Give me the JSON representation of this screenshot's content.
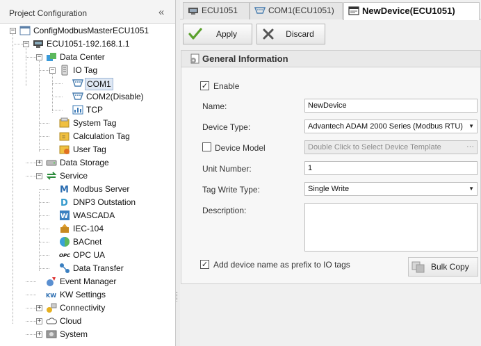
{
  "left_panel": {
    "title": "Project Configuration",
    "collapse_glyph": "«",
    "tree": [
      {
        "label": "ConfigModbusMasterECU1051",
        "icon": "project-icon",
        "expander": "−"
      },
      {
        "label": "ECU1051-192.168.1.1",
        "icon": "device-icon",
        "expander": "−"
      },
      {
        "label": "Data Center",
        "icon": "data-center-icon",
        "expander": "−"
      },
      {
        "label": "IO Tag",
        "icon": "io-tag-icon",
        "expander": "−"
      },
      {
        "label": "COM1",
        "icon": "com-port-icon",
        "selected": true
      },
      {
        "label": "COM2(Disable)",
        "icon": "com-port-icon"
      },
      {
        "label": "TCP",
        "icon": "tcp-icon"
      },
      {
        "label": "System Tag",
        "icon": "system-tag-icon"
      },
      {
        "label": "Calculation Tag",
        "icon": "calculation-tag-icon"
      },
      {
        "label": "User Tag",
        "icon": "user-tag-icon"
      },
      {
        "label": "Data Storage",
        "icon": "data-storage-icon",
        "expander": "+"
      },
      {
        "label": "Service",
        "icon": "service-icon",
        "expander": "−"
      },
      {
        "label": "Modbus Server",
        "icon": "modbus-icon"
      },
      {
        "label": "DNP3 Outstation",
        "icon": "dnp3-icon"
      },
      {
        "label": "WASCADA",
        "icon": "wascada-icon"
      },
      {
        "label": "IEC-104",
        "icon": "iec104-icon"
      },
      {
        "label": "BACnet",
        "icon": "bacnet-icon"
      },
      {
        "label": "OPC UA",
        "icon": "opc-ua-icon"
      },
      {
        "label": "Data Transfer",
        "icon": "data-transfer-icon"
      },
      {
        "label": "Event Manager",
        "icon": "event-manager-icon"
      },
      {
        "label": "KW Settings",
        "icon": "kw-settings-icon"
      },
      {
        "label": "Connectivity",
        "icon": "connectivity-icon",
        "expander": "+"
      },
      {
        "label": "Cloud",
        "icon": "cloud-icon",
        "expander": "+"
      },
      {
        "label": "System",
        "icon": "system-icon",
        "expander": "+"
      }
    ]
  },
  "tabs": [
    {
      "label": "ECU1051",
      "icon": "device-icon"
    },
    {
      "label": "COM1(ECU1051)",
      "icon": "com-port-icon"
    },
    {
      "label": "NewDevice(ECU1051)",
      "icon": "device-window-icon",
      "active": true
    }
  ],
  "toolbar": {
    "apply_label": "Apply",
    "discard_label": "Discard"
  },
  "form": {
    "section_title": "General Information",
    "enable_label": "Enable",
    "enable_checked": true,
    "name_label": "Name:",
    "name_value": "NewDevice",
    "device_type_label": "Device Type:",
    "device_type_value": "Advantech ADAM 2000 Series (Modbus RTU)",
    "device_model_label": "Device Model",
    "device_model_checked": false,
    "device_model_value": "Double Click to Select Device Template",
    "unit_number_label": "Unit Number:",
    "unit_number_value": "1",
    "tag_write_type_label": "Tag Write Type:",
    "tag_write_type_value": "Single Write",
    "description_label": "Description:",
    "description_value": "",
    "prefix_label": "Add device name as prefix to IO tags",
    "prefix_checked": true,
    "bulk_copy_label": "Bulk Copy"
  },
  "colors": {
    "apply_check": "#5aa02c",
    "discard_x": "#555555",
    "selection_bg": "#dfe8f4"
  }
}
